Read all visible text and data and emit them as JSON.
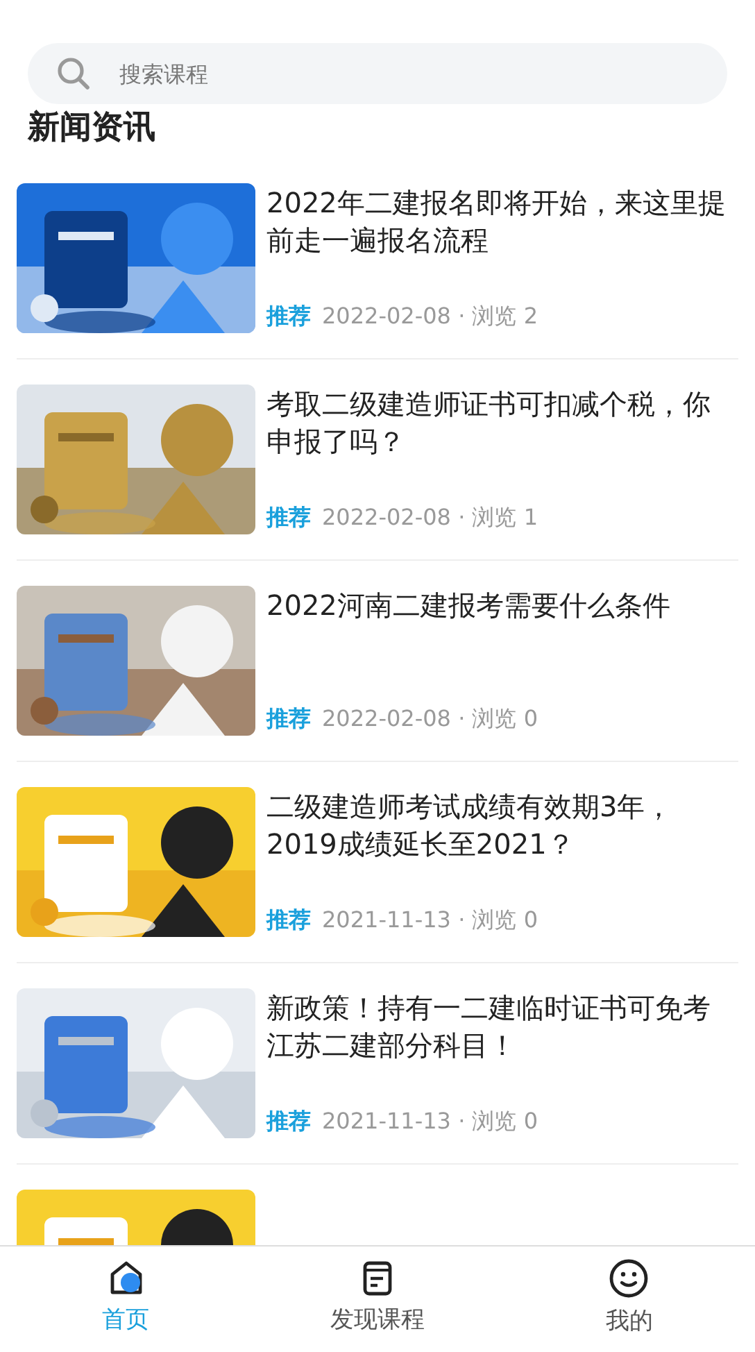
{
  "search": {
    "placeholder": "搜索课程"
  },
  "section_title": "新闻资讯",
  "articles": [
    {
      "thumbnail": {
        "kind": "picture"
      },
      "title": "2022年二建报名即将开始，来这里提前走一遍报名流程",
      "tag": "推荐",
      "meta": "2022-02-08 · 浏览 2"
    },
    {
      "thumbnail": {
        "kind": "picture"
      },
      "title": "考取二级建造师证书可扣减个税，你申报了吗？",
      "tag": "推荐",
      "meta": "2022-02-08 · 浏览 1"
    },
    {
      "thumbnail": {
        "kind": "picture"
      },
      "title": "2022河南二建报考需要什么条件",
      "tag": "推荐",
      "meta": "2022-02-08 · 浏览 0"
    },
    {
      "thumbnail": {
        "kind": "picture"
      },
      "title": "二级建造师考试成绩有效期3年，2019成绩延长至2021？",
      "tag": "推荐",
      "meta": "2021-11-13 · 浏览 0"
    },
    {
      "thumbnail": {
        "kind": "picture"
      },
      "title": "新政策！持有一二建临时证书可免考江苏二建部分科目！",
      "tag": "推荐",
      "meta": "2021-11-13 · 浏览 0"
    },
    {
      "thumbnail": {
        "kind": "picture"
      }
    }
  ],
  "bottom_nav": [
    {
      "label": "首页",
      "selected": true
    },
    {
      "label": "发现课程",
      "selected": false
    },
    {
      "label": "我的",
      "selected": false
    }
  ]
}
